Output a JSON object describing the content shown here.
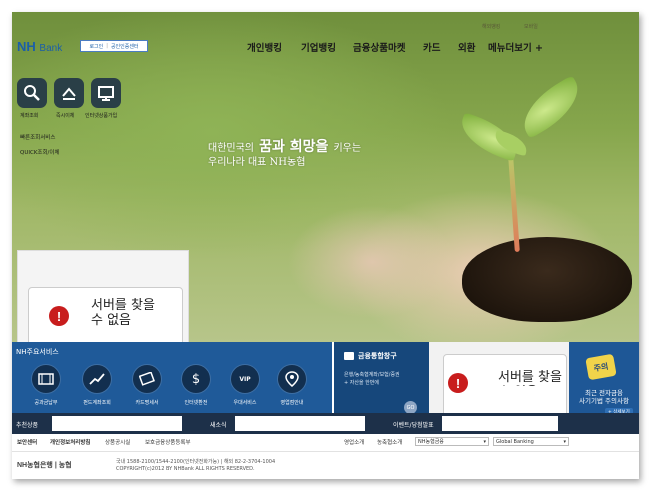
{
  "header": {
    "logo": "NH",
    "logo_sub": "Bank",
    "login_label": "로그인",
    "cert_label": "공인인증센터",
    "util_links": [
      "해외뱅킹",
      "모바일"
    ],
    "nav": [
      "개인뱅킹",
      "기업뱅킹",
      "금융상품마켓",
      "카드",
      "외환",
      "메뉴더보기 +"
    ]
  },
  "quick": {
    "items": [
      {
        "label": "계좌조회",
        "icon": "search-icon"
      },
      {
        "label": "즉시이체",
        "icon": "transfer-icon"
      },
      {
        "label": "인터넷상품가입",
        "icon": "monitor-icon"
      }
    ],
    "links": [
      "빠른조회서비스",
      "QUICK조회/이체"
    ]
  },
  "hero": {
    "line1_prefix": "대한민국의",
    "line1_emph": "꿈과 희망을",
    "line1_suffix": "키우는",
    "line2": "우리나라 대표 NH농협"
  },
  "error_message": "서버를 찾을 수 없음",
  "services": {
    "title": "NH주요서비스",
    "items": [
      {
        "label": "공과금납부",
        "icon": "film-icon"
      },
      {
        "label": "펀드계좌조회",
        "icon": "chart-icon"
      },
      {
        "label": "카드명세서",
        "icon": "card-icon"
      },
      {
        "label": "인터넷환전",
        "icon": "dollar-icon"
      },
      {
        "label": "우대서비스",
        "icon": "vip-icon"
      },
      {
        "label": "영업점안내",
        "icon": "map-pin-icon"
      }
    ]
  },
  "financial": {
    "title": "금융통합창구",
    "desc_line1": "은행/농축협계좌/보험/증권",
    "desc_line2": "+ 자산을 한번에",
    "go": "GO"
  },
  "promo": {
    "badge": "주의",
    "line1": "최근 전자금융",
    "line2": "사기기법 주의사항",
    "button": "+ 상세보기"
  },
  "strip": {
    "recommend": "추천상품",
    "notice": "새소식",
    "event": "이벤트/당첨발표"
  },
  "footer": {
    "links": [
      "보안센터",
      "개인정보처리방침",
      "상품공시실",
      "보호금융상품등록부"
    ],
    "links_right": [
      "영업소개",
      "농축협소개"
    ],
    "select1": "NH농협금융",
    "select2": "Global Banking",
    "logo": "NH농협은행 | 농협",
    "address1": "국내 1588-2100/1544-2100(인터넷전화가능) | 해외 82-2-3704-1004",
    "address2": "COPYRIGHT(c)2012 BY NHBank ALL RIGHTS RESERVED."
  }
}
